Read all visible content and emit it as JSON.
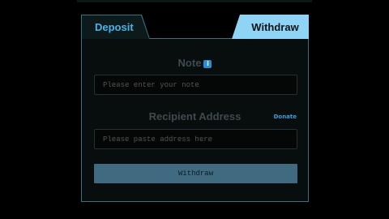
{
  "tabs": {
    "deposit_label": "Deposit",
    "withdraw_label": "Withdraw",
    "active": "Withdraw"
  },
  "note": {
    "label": "Note",
    "info_icon": "info-icon",
    "info_glyph": "i",
    "placeholder": "Please enter your note",
    "value": ""
  },
  "recipient": {
    "label": "Recipient Address",
    "donate_label": "Donate",
    "placeholder": "Please paste address here",
    "value": ""
  },
  "submit": {
    "label": "Withdraw"
  },
  "colors": {
    "accent": "#8fd3f5",
    "tab_text": "#4ab3e8",
    "panel_border": "#3b7282",
    "button": "#3f6a80",
    "info": "#2a8bd6"
  }
}
